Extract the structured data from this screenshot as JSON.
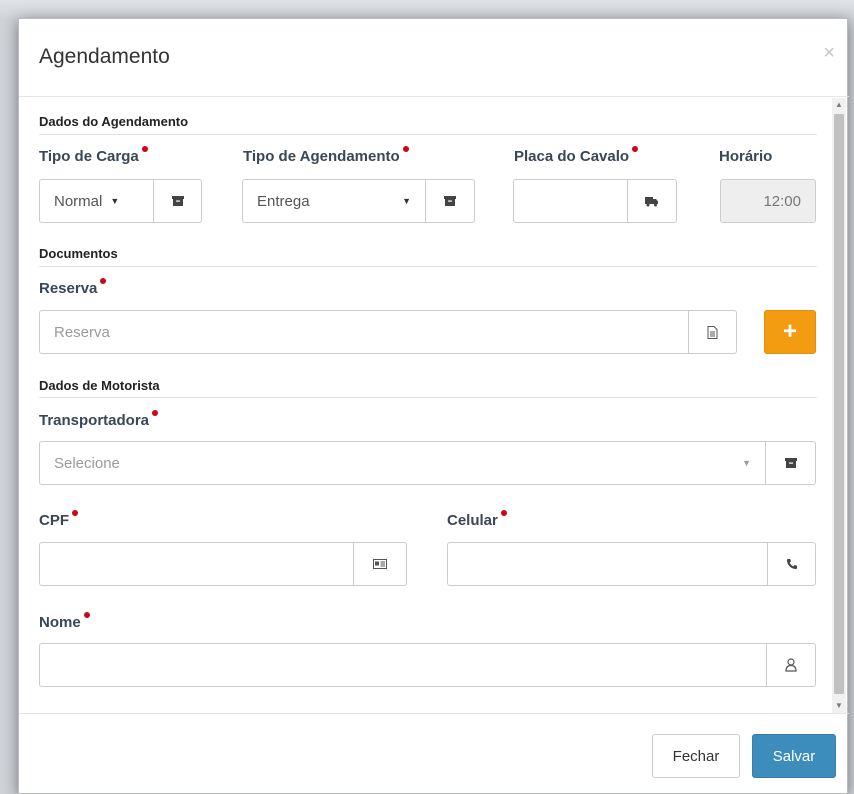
{
  "modal": {
    "title": "Agendamento",
    "close_label": "×"
  },
  "sections": {
    "agendamento": "Dados do Agendamento",
    "documentos": "Documentos",
    "motorista": "Dados de Motorista"
  },
  "fields": {
    "tipo_carga": {
      "label": "Tipo de Carga",
      "value": "Normal",
      "icon": "archive-icon"
    },
    "tipo_agendamento": {
      "label": "Tipo de Agendamento",
      "value": "Entrega",
      "icon": "archive-icon"
    },
    "placa_cavalo": {
      "label": "Placa do Cavalo",
      "value": "",
      "icon": "truck-icon"
    },
    "horario": {
      "label": "Horário",
      "value": "12:00"
    },
    "reserva": {
      "label": "Reserva",
      "placeholder": "Reserva",
      "icon": "document-icon"
    },
    "transportadora": {
      "label": "Transportadora",
      "placeholder": "Selecione",
      "icon": "archive-icon"
    },
    "cpf": {
      "label": "CPF",
      "value": "",
      "icon": "id-card-icon"
    },
    "celular": {
      "label": "Celular",
      "value": "",
      "icon": "phone-icon"
    },
    "nome": {
      "label": "Nome",
      "value": "",
      "icon": "user-icon"
    }
  },
  "buttons": {
    "add": "+",
    "fechar": "Fechar",
    "salvar": "Salvar"
  },
  "colors": {
    "required": "#d0021b",
    "add_button": "#f39c12",
    "primary": "#3c8dbc"
  }
}
